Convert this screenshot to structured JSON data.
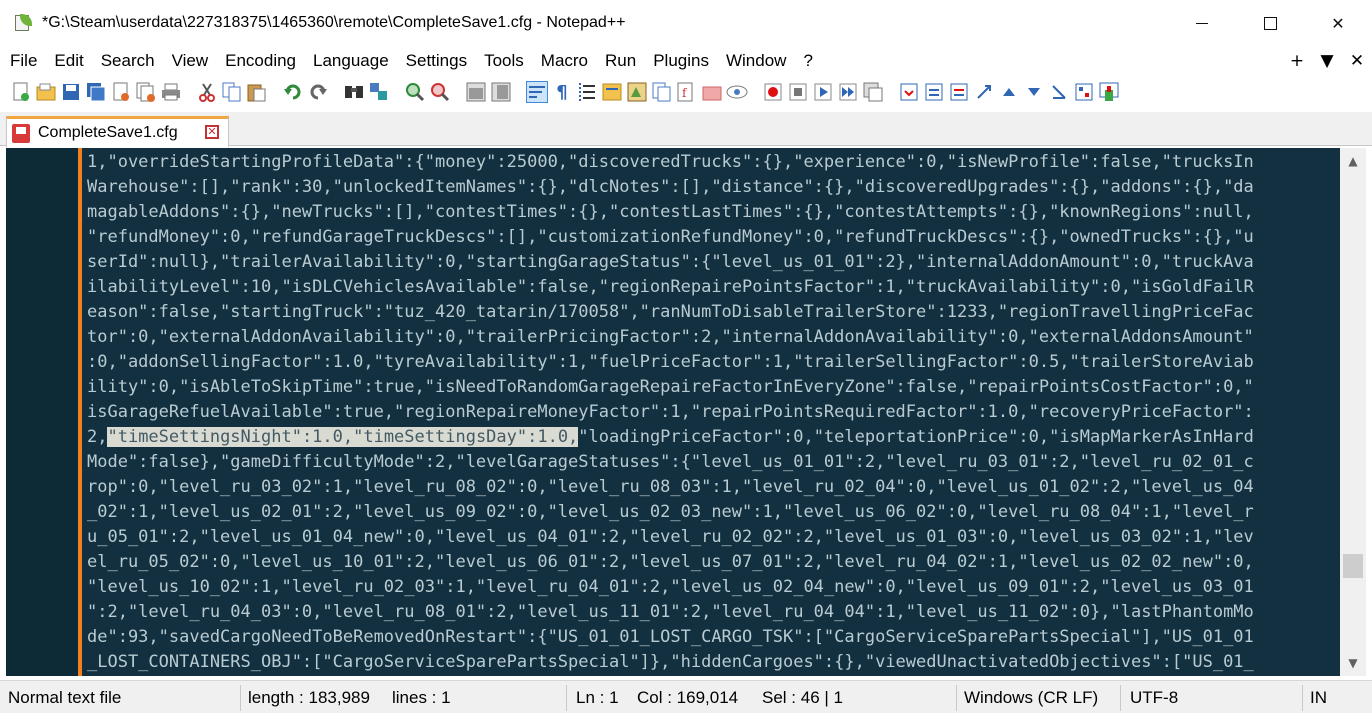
{
  "window": {
    "title": "*G:\\Steam\\userdata\\227318375\\1465360\\remote\\CompleteSave1.cfg - Notepad++",
    "controls": [
      "minimize",
      "maximize",
      "close"
    ]
  },
  "menu": {
    "items": [
      "File",
      "Edit",
      "Search",
      "View",
      "Encoding",
      "Language",
      "Settings",
      "Tools",
      "Macro",
      "Run",
      "Plugins",
      "Window",
      "?"
    ],
    "right": [
      "+",
      "▼",
      "✕"
    ]
  },
  "toolbar": {
    "icons": [
      "new-file-icon",
      "open-file-icon",
      "save-icon",
      "save-all-icon",
      "close-icon",
      "close-all-icon",
      "print-icon",
      "cut-icon",
      "copy-icon",
      "paste-icon",
      "undo-icon",
      "redo-icon",
      "find-icon",
      "replace-icon",
      "zoom-in-icon",
      "zoom-out-icon",
      "sync-vertical-icon",
      "sync-horizontal-icon",
      "word-wrap-icon",
      "show-all-chars-icon",
      "indent-guide-icon",
      "user-language-icon",
      "doc-map-icon",
      "doc-list-icon",
      "function-list-icon",
      "folder-workspace-icon",
      "monitoring-icon",
      "record-macro-icon",
      "stop-record-icon",
      "play-macro-icon",
      "run-macro-multiple-icon",
      "save-macro-icon",
      "plugin-icon-1",
      "plugin-icon-2",
      "plugin-icon-3",
      "plugin-icon-4",
      "arrow-up-icon",
      "arrow-down-icon",
      "plugin-icon-5",
      "plugin-icon-6",
      "plugin-icon-7"
    ]
  },
  "tab": {
    "label": "CompleteSave1.cfg"
  },
  "editor": {
    "lines": [
      "1,\"overrideStartingProfileData\":{\"money\":25000,\"discoveredTrucks\":{},\"experience\":0,\"isNewProfile\":false,\"trucksIn",
      "Warehouse\":[],\"rank\":30,\"unlockedItemNames\":{},\"dlcNotes\":[],\"distance\":{},\"discoveredUpgrades\":{},\"addons\":{},\"da",
      "magableAddons\":{},\"newTrucks\":[],\"contestTimes\":{},\"contestLastTimes\":{},\"contestAttempts\":{},\"knownRegions\":null,",
      "\"refundMoney\":0,\"refundGarageTruckDescs\":[],\"customizationRefundMoney\":0,\"refundTruckDescs\":{},\"ownedTrucks\":{},\"u",
      "serId\":null},\"trailerAvailability\":0,\"startingGarageStatus\":{\"level_us_01_01\":2},\"internalAddonAmount\":0,\"truckAva",
      "ilabilityLevel\":10,\"isDLCVehiclesAvailable\":false,\"regionRepairePointsFactor\":1,\"truckAvailability\":0,\"isGoldFailR",
      "eason\":false,\"startingTruck\":\"tuz_420_tatarin/170058\",\"ranNumToDisableTrailerStore\":1233,\"regionTravellingPriceFac",
      "tor\":0,\"externalAddonAvailability\":0,\"trailerPricingFactor\":2,\"internalAddonAvailability\":0,\"externalAddonsAmount\"",
      ":0,\"addonSellingFactor\":1.0,\"tyreAvailability\":1,\"fuelPriceFactor\":1,\"trailerSellingFactor\":0.5,\"trailerStoreAviab",
      "ility\":0,\"isAbleToSkipTime\":true,\"isNeedToRandomGarageRepaireFactorInEveryZone\":false,\"repairPointsCostFactor\":0,\"",
      "isGarageRefuelAvailable\":true,\"regionRepaireMoneyFactor\":1,\"repairPointsRequiredFactor\":1.0,\"recoveryPriceFactor\":"
    ],
    "highlight_line": {
      "before": "2,",
      "selected": "\"timeSettingsNight\":1.0,\"timeSettingsDay\":1.0,",
      "after": "\"loadingPriceFactor\":0,\"teleportationPrice\":0,\"isMapMarkerAsInHard"
    },
    "lines_after": [
      "Mode\":false},\"gameDifficultyMode\":2,\"levelGarageStatuses\":{\"level_us_01_01\":2,\"level_ru_03_01\":2,\"level_ru_02_01_c",
      "rop\":0,\"level_ru_03_02\":1,\"level_ru_08_02\":0,\"level_ru_08_03\":1,\"level_ru_02_04\":0,\"level_us_01_02\":2,\"level_us_04",
      "_02\":1,\"level_us_02_01\":2,\"level_us_09_02\":0,\"level_us_02_03_new\":1,\"level_us_06_02\":0,\"level_ru_08_04\":1,\"level_r",
      "u_05_01\":2,\"level_us_01_04_new\":0,\"level_us_04_01\":2,\"level_ru_02_02\":2,\"level_us_01_03\":0,\"level_us_03_02\":1,\"lev",
      "el_ru_05_02\":0,\"level_us_10_01\":2,\"level_us_06_01\":2,\"level_us_07_01\":2,\"level_ru_04_02\":1,\"level_us_02_02_new\":0,",
      "\"level_us_10_02\":1,\"level_ru_02_03\":1,\"level_ru_04_01\":2,\"level_us_02_04_new\":0,\"level_us_09_01\":2,\"level_us_03_01",
      "\":2,\"level_ru_04_03\":0,\"level_ru_08_01\":2,\"level_us_11_01\":2,\"level_ru_04_04\":1,\"level_us_11_02\":0},\"lastPhantomMo",
      "de\":93,\"savedCargoNeedToBeRemovedOnRestart\":{\"US_01_01_LOST_CARGO_TSK\":[\"CargoServiceSparePartsSpecial\"],\"US_01_01",
      "_LOST_CONTAINERS_OBJ\":[\"CargoServiceSparePartsSpecial\"]},\"hiddenCargoes\":{},\"viewedUnactivatedObjectives\":[\"US_01_"
    ]
  },
  "scrollbar": {
    "up": "▲",
    "down": "▼",
    "position": 0.84
  },
  "status": {
    "file_type": "Normal text file",
    "length": "length : 183,989",
    "lines": "lines : 1",
    "ln": "Ln : 1",
    "col": "Col : 169,014",
    "sel": "Sel : 46 | 1",
    "eol": "Windows (CR LF)",
    "encoding": "UTF-8",
    "mode": "IN"
  },
  "colors": {
    "editor_bg": "#12303f",
    "editor_text": "#b9cbd2",
    "selection": "#d9dbd2",
    "fold_margin": "#f08020",
    "tab_accent": "#f0a541"
  }
}
